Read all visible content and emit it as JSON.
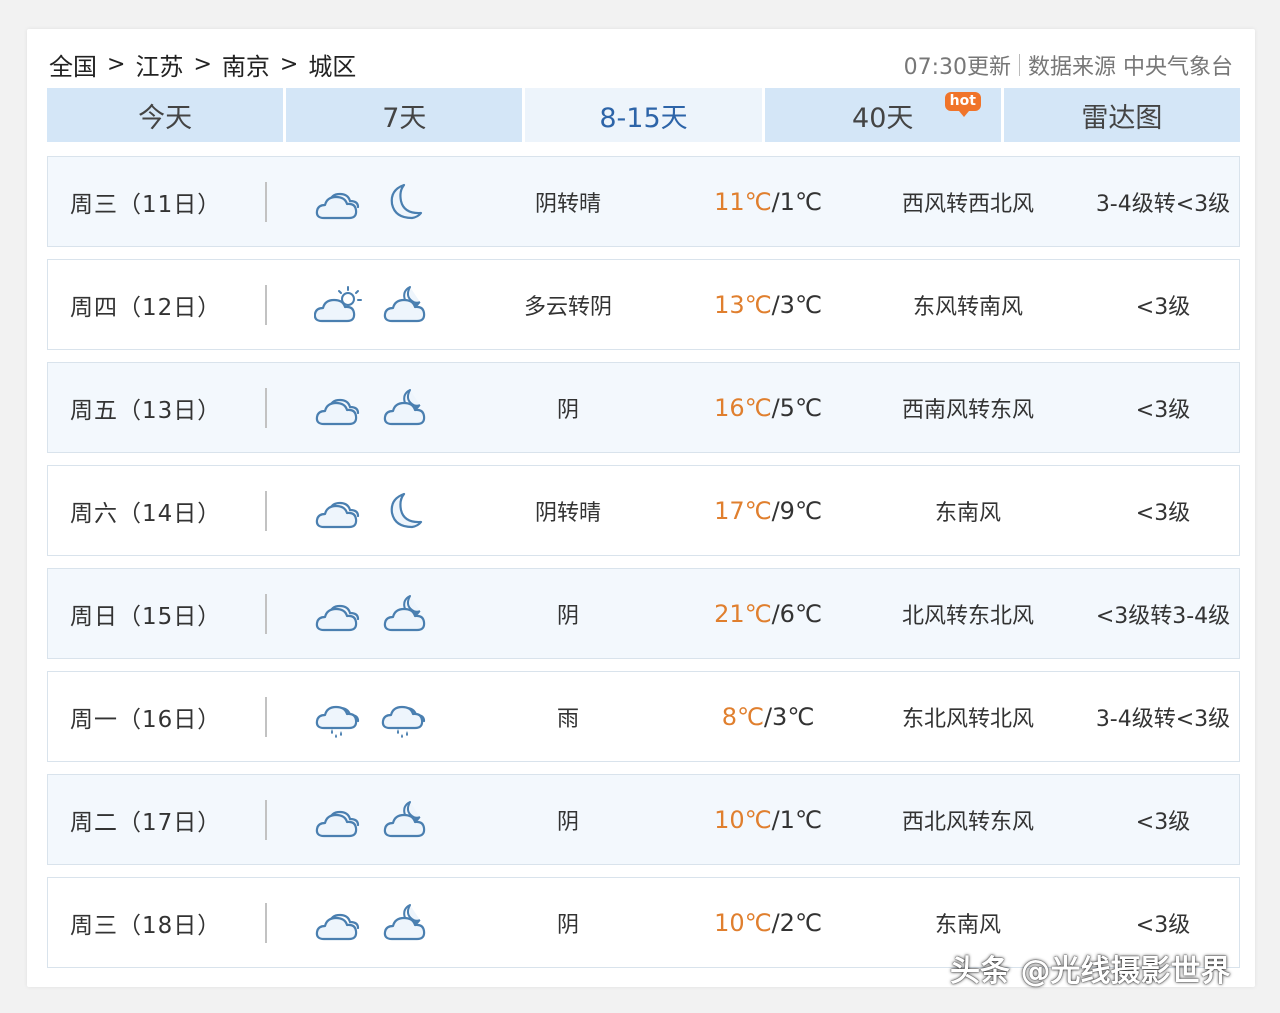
{
  "breadcrumb": [
    "全国",
    "江苏",
    "南京",
    "城区"
  ],
  "breadcrumb_sep": ">",
  "meta": {
    "updated": "07:30更新",
    "source": "数据来源 中央气象台"
  },
  "tabs": [
    {
      "label": "今天",
      "active": false
    },
    {
      "label": "7天",
      "active": false
    },
    {
      "label": "8-15天",
      "active": true
    },
    {
      "label": "40天",
      "active": false,
      "badge": "hot"
    },
    {
      "label": "雷达图",
      "active": false
    }
  ],
  "colors": {
    "high_temp": "#e07f2e",
    "active_tab_text": "#2d64a8",
    "tab_bg": "#d4e6f7"
  },
  "forecast": [
    {
      "day": "周三（11日）",
      "icon_day": "cloudy-icon",
      "icon_night": "moon-icon",
      "desc": "阴转晴",
      "high": "11℃",
      "low": "1℃",
      "wind": "西风转西北风",
      "level": "3-4级转<3级"
    },
    {
      "day": "周四（12日）",
      "icon_day": "partly-cloudy-day-icon",
      "icon_night": "cloudy-night-icon",
      "desc": "多云转阴",
      "high": "13℃",
      "low": "3℃",
      "wind": "东风转南风",
      "level": "<3级"
    },
    {
      "day": "周五（13日）",
      "icon_day": "cloudy-icon",
      "icon_night": "cloudy-night-icon",
      "desc": "阴",
      "high": "16℃",
      "low": "5℃",
      "wind": "西南风转东风",
      "level": "<3级"
    },
    {
      "day": "周六（14日）",
      "icon_day": "cloudy-icon",
      "icon_night": "moon-icon",
      "desc": "阴转晴",
      "high": "17℃",
      "low": "9℃",
      "wind": "东南风",
      "level": "<3级"
    },
    {
      "day": "周日（15日）",
      "icon_day": "cloudy-icon",
      "icon_night": "cloudy-night-icon",
      "desc": "阴",
      "high": "21℃",
      "low": "6℃",
      "wind": "北风转东北风",
      "level": "<3级转3-4级"
    },
    {
      "day": "周一（16日）",
      "icon_day": "rain-icon",
      "icon_night": "rain-icon",
      "desc": "雨",
      "high": "8℃",
      "low": "3℃",
      "wind": "东北风转北风",
      "level": "3-4级转<3级"
    },
    {
      "day": "周二（17日）",
      "icon_day": "cloudy-icon",
      "icon_night": "cloudy-night-icon",
      "desc": "阴",
      "high": "10℃",
      "low": "1℃",
      "wind": "西北风转东风",
      "level": "<3级"
    },
    {
      "day": "周三（18日）",
      "icon_day": "cloudy-icon",
      "icon_night": "cloudy-night-icon",
      "desc": "阴",
      "high": "10℃",
      "low": "2℃",
      "wind": "东南风",
      "level": "<3级"
    }
  ],
  "watermark": "头条 @光线摄影世界"
}
